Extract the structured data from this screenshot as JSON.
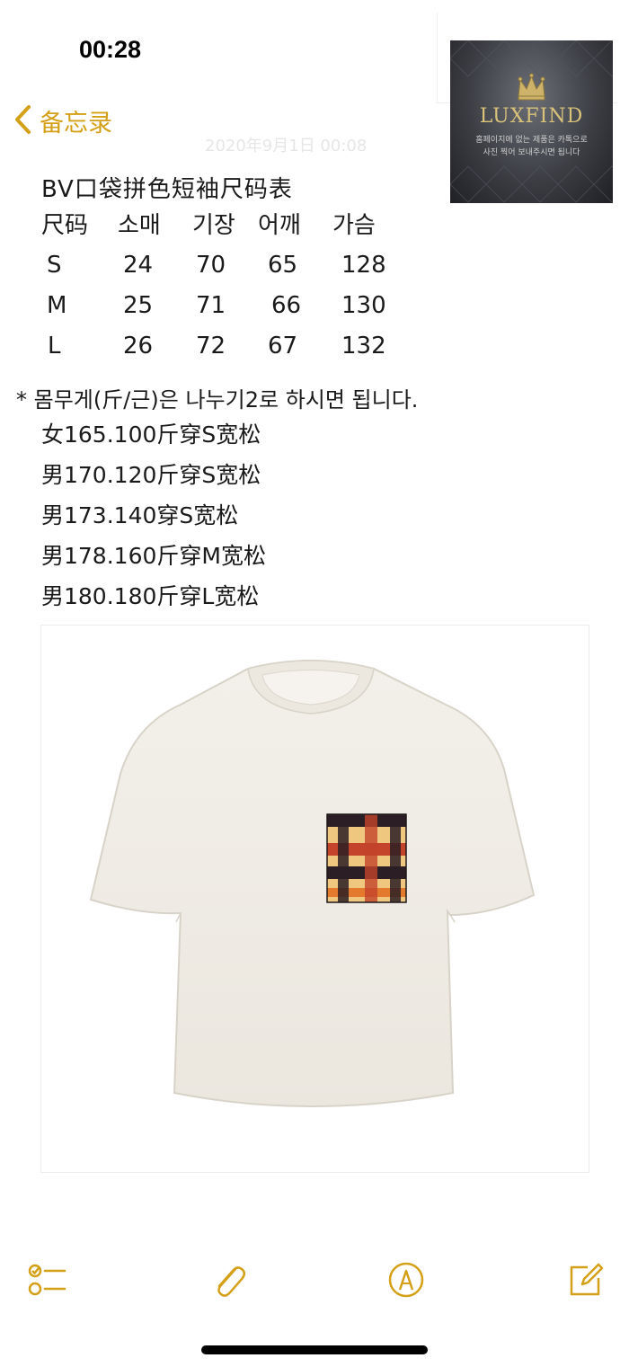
{
  "status": {
    "time": "00:28"
  },
  "nav": {
    "back_label": "备忘录"
  },
  "note": {
    "date_ghost": "2020年9月1日 00:08",
    "title": "BV口袋拼色短袖尺码表",
    "table": {
      "headers": [
        "尺码",
        "소매",
        "기장",
        "어깨",
        "가슴"
      ],
      "rows": [
        [
          "S",
          "24",
          "70",
          "65",
          "128"
        ],
        [
          "M",
          "25",
          "71",
          "66",
          "130"
        ],
        [
          "L",
          "26",
          "72",
          "67",
          "132"
        ]
      ]
    },
    "weight_note": "* 몸무게(斤/근)은 나누기2로 하시면 됩니다.",
    "recommendations": [
      "女165.100斤穿S宽松",
      "男170.120斤穿S宽松",
      "男173.140穿S宽松",
      "男178.160斤穿M宽松",
      "男180.180斤穿L宽松"
    ]
  },
  "watermark": {
    "brand": "LUXFIND",
    "line1": "홈페이지에 없는 제품은 카톡으로",
    "line2": "사진 찍어 보내주시면 됩니다"
  },
  "toolbar": {
    "icons": [
      "checklist-icon",
      "paperclip-icon",
      "markup-pen-icon",
      "compose-icon"
    ],
    "accent_color": "#d4a017"
  },
  "product_image": {
    "description_icon": "white-tshirt-with-plaid-pocket"
  }
}
